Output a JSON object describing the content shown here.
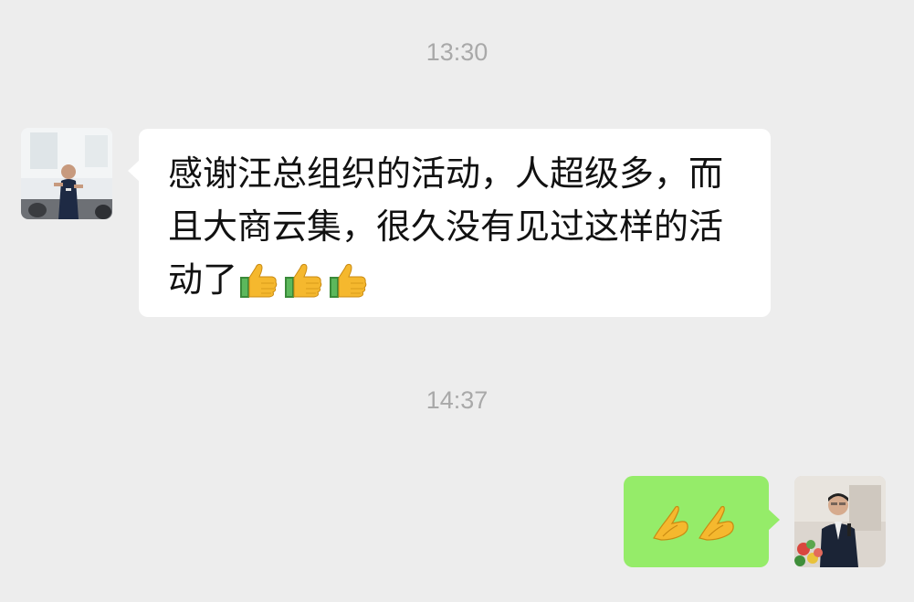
{
  "timestamps": [
    "13:30",
    "14:37"
  ],
  "messages": [
    {
      "side": "left",
      "text": "感谢汪总组织的活动，人超级多，而且大商云集，很久没有见过这样的活动了",
      "emoji": [
        "thumbs-up",
        "thumbs-up",
        "thumbs-up"
      ]
    },
    {
      "side": "right",
      "emoji": [
        "folded-hands",
        "folded-hands"
      ]
    }
  ],
  "colors": {
    "background": "#ededed",
    "incoming_bubble": "#ffffff",
    "outgoing_bubble": "#95ec69",
    "timestamp": "#a9a9a9"
  }
}
